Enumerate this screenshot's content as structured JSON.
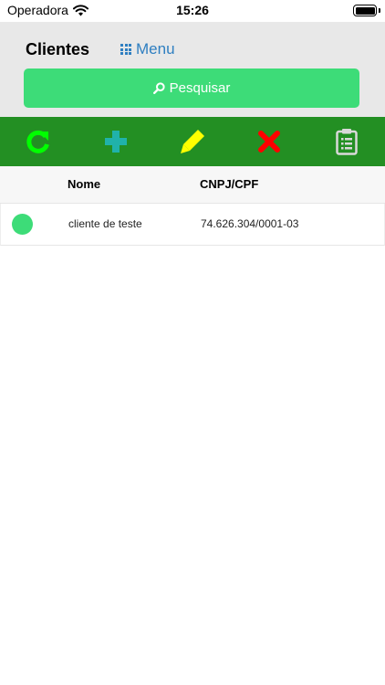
{
  "status_bar": {
    "carrier": "Operadora",
    "time": "15:26",
    "icons": [
      "wifi-icon",
      "battery-icon"
    ]
  },
  "header": {
    "title": "Clientes",
    "menu_label": "Menu",
    "search_label": "Pesquisar"
  },
  "toolbar": {
    "icons": [
      "refresh-icon",
      "add-icon",
      "edit-icon",
      "delete-icon",
      "clipboard-icon"
    ]
  },
  "colors": {
    "header_bg": "#e8e8e8",
    "accent_green": "#3ddc78",
    "toolbar_green": "#238f23",
    "menu_blue": "#2f7fc1",
    "refresh": "#00ff00",
    "add": "#20b2aa",
    "edit": "#ffff00",
    "delete": "#ff0000",
    "clipboard": "#d9d9d9"
  },
  "table": {
    "columns": [
      "",
      "Nome",
      "CNPJ/CPF"
    ],
    "rows": [
      {
        "status": "active",
        "name": "cliente de teste",
        "doc": "74.626.304/0001-03"
      }
    ]
  }
}
